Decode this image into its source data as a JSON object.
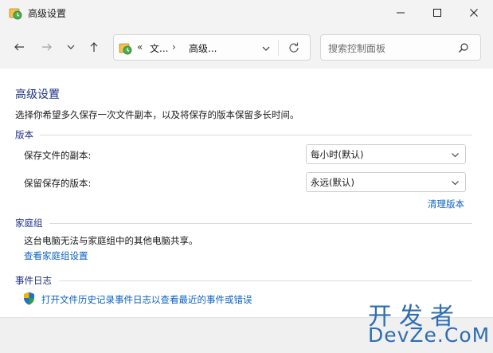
{
  "window": {
    "title": "高级设置"
  },
  "nav": {
    "address": {
      "prefix": "«",
      "crumbs": [
        "文...",
        "高级..."
      ],
      "separator": "›"
    },
    "search_placeholder": "搜索控制面板"
  },
  "page": {
    "title": "高级设置",
    "description": "选择你希望多久保存一次文件副本，以及将保存的版本保留多长时间。"
  },
  "versions": {
    "heading": "版本",
    "save_copies_label": "保存文件的副本:",
    "save_copies_value": "每小时(默认)",
    "keep_versions_label": "保留保存的版本:",
    "keep_versions_value": "永远(默认)",
    "cleanup_link": "清理版本"
  },
  "homegroup": {
    "heading": "家庭组",
    "info": "这台电脑无法与家庭组中的其他电脑共享。",
    "settings_link": "查看家庭组设置"
  },
  "eventlog": {
    "heading": "事件日志",
    "open_link": "打开文件历史记录事件日志以查看最近的事件或错误"
  },
  "watermark": {
    "line1": "开发者",
    "line2": "DevZe.CoM"
  },
  "colors": {
    "heading_blue": "#1e3287",
    "link_blue": "#0b61c4",
    "titlebar_bg": "#f3f3f3"
  }
}
